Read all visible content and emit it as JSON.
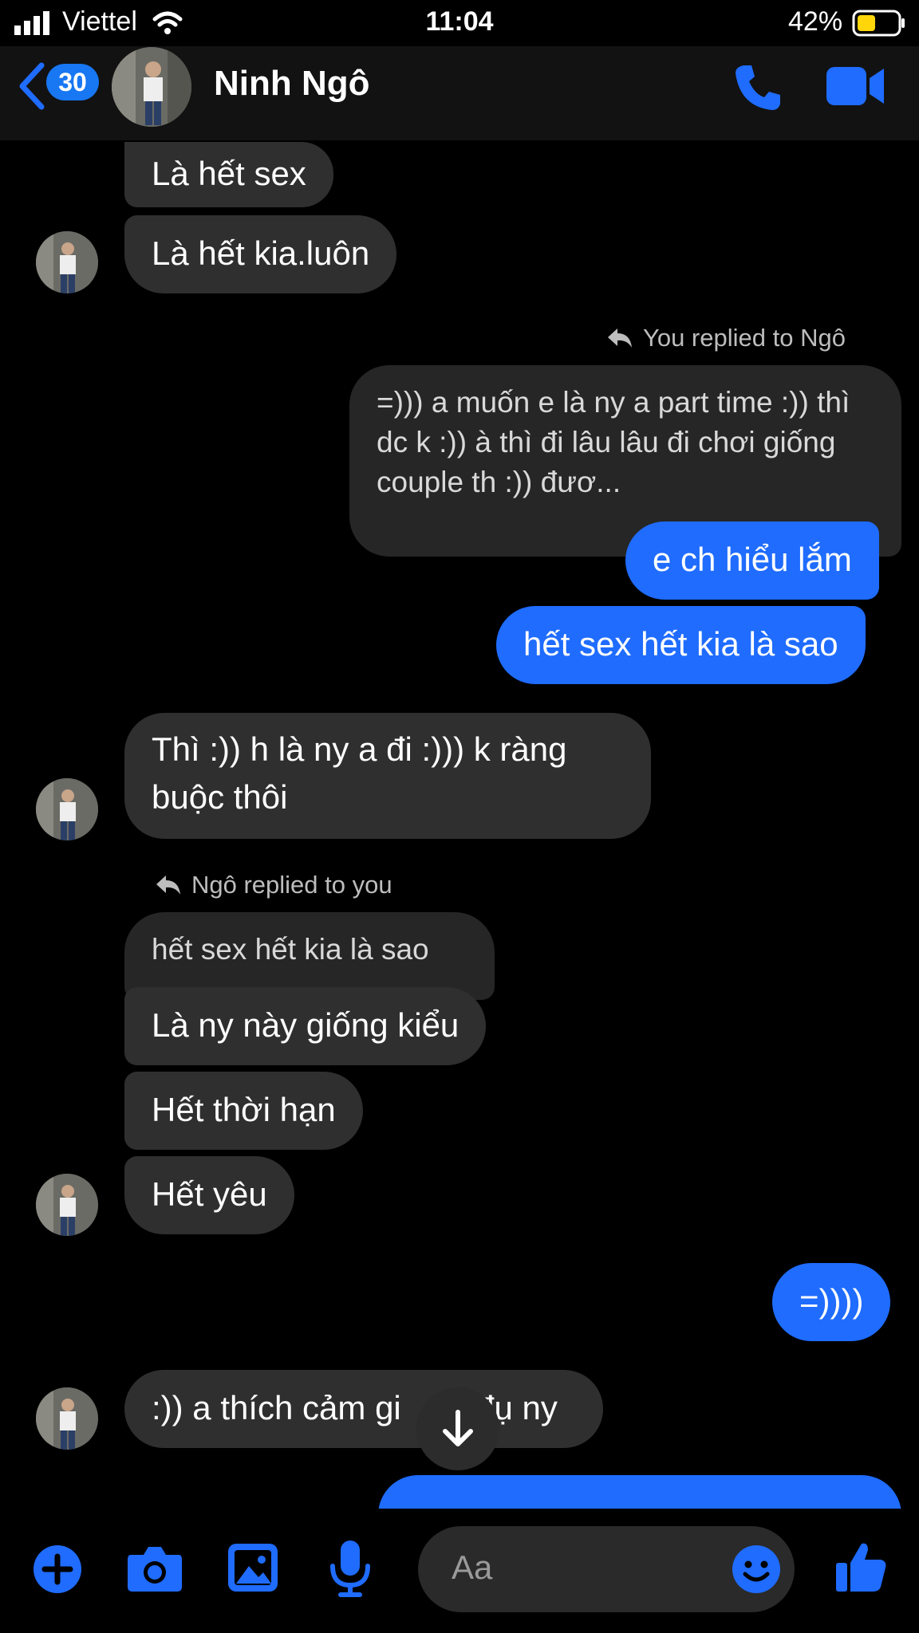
{
  "status_bar": {
    "carrier": "Viettel",
    "time": "11:04",
    "battery_pct": "42%"
  },
  "header": {
    "back_count": "30",
    "contact_name": "Ninh Ngô"
  },
  "messages": {
    "m1": "Là hết sex",
    "m2": "Là hết kia.luôn",
    "reply_label_1": "You replied to Ngô",
    "quote_1": "=))) a muốn e là ny a part time :)) thì dc k :)) à thì đi lâu lâu đi chơi giống couple th :)) đươ...",
    "m3": "e ch hiểu lắm",
    "m4": "hết sex hết kia là sao",
    "m5": "Thì :)) h là ny a đi :))) k ràng buộc thôi",
    "reply_label_2": "Ngô replied to you",
    "quote_2": "hết sex hết kia là sao",
    "m6": "Là ny này giống kiểu",
    "m7": "Hết thời hạn",
    "m8": "Hết yêu",
    "m9": "=))))",
    "m10": ":)) a thích cảm gi",
    "m10_tail": "đụ ny"
  },
  "composer": {
    "placeholder": "Aa"
  },
  "colors": {
    "accent": "#1f6cff",
    "incoming_bubble": "#2f2f2f",
    "background": "#000000"
  },
  "icons": [
    "back-chevron-icon",
    "phone-icon",
    "video-camera-icon",
    "plus-icon",
    "camera-icon",
    "image-icon",
    "microphone-icon",
    "emoji-icon",
    "thumbs-up-icon",
    "arrow-down-icon",
    "wifi-icon",
    "signal-icon",
    "battery-icon",
    "reply-icon"
  ]
}
